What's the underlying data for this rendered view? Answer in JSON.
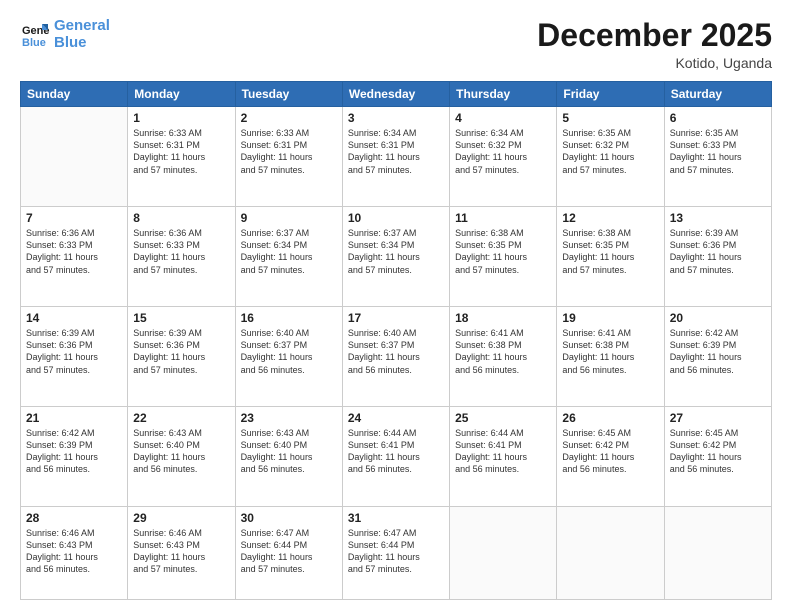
{
  "logo": {
    "line1": "General",
    "line2": "Blue"
  },
  "title": "December 2025",
  "subtitle": "Kotido, Uganda",
  "days_of_week": [
    "Sunday",
    "Monday",
    "Tuesday",
    "Wednesday",
    "Thursday",
    "Friday",
    "Saturday"
  ],
  "weeks": [
    [
      {
        "day": "",
        "info": ""
      },
      {
        "day": "1",
        "info": "Sunrise: 6:33 AM\nSunset: 6:31 PM\nDaylight: 11 hours\nand 57 minutes."
      },
      {
        "day": "2",
        "info": "Sunrise: 6:33 AM\nSunset: 6:31 PM\nDaylight: 11 hours\nand 57 minutes."
      },
      {
        "day": "3",
        "info": "Sunrise: 6:34 AM\nSunset: 6:31 PM\nDaylight: 11 hours\nand 57 minutes."
      },
      {
        "day": "4",
        "info": "Sunrise: 6:34 AM\nSunset: 6:32 PM\nDaylight: 11 hours\nand 57 minutes."
      },
      {
        "day": "5",
        "info": "Sunrise: 6:35 AM\nSunset: 6:32 PM\nDaylight: 11 hours\nand 57 minutes."
      },
      {
        "day": "6",
        "info": "Sunrise: 6:35 AM\nSunset: 6:33 PM\nDaylight: 11 hours\nand 57 minutes."
      }
    ],
    [
      {
        "day": "7",
        "info": "Sunrise: 6:36 AM\nSunset: 6:33 PM\nDaylight: 11 hours\nand 57 minutes."
      },
      {
        "day": "8",
        "info": "Sunrise: 6:36 AM\nSunset: 6:33 PM\nDaylight: 11 hours\nand 57 minutes."
      },
      {
        "day": "9",
        "info": "Sunrise: 6:37 AM\nSunset: 6:34 PM\nDaylight: 11 hours\nand 57 minutes."
      },
      {
        "day": "10",
        "info": "Sunrise: 6:37 AM\nSunset: 6:34 PM\nDaylight: 11 hours\nand 57 minutes."
      },
      {
        "day": "11",
        "info": "Sunrise: 6:38 AM\nSunset: 6:35 PM\nDaylight: 11 hours\nand 57 minutes."
      },
      {
        "day": "12",
        "info": "Sunrise: 6:38 AM\nSunset: 6:35 PM\nDaylight: 11 hours\nand 57 minutes."
      },
      {
        "day": "13",
        "info": "Sunrise: 6:39 AM\nSunset: 6:36 PM\nDaylight: 11 hours\nand 57 minutes."
      }
    ],
    [
      {
        "day": "14",
        "info": "Sunrise: 6:39 AM\nSunset: 6:36 PM\nDaylight: 11 hours\nand 57 minutes."
      },
      {
        "day": "15",
        "info": "Sunrise: 6:39 AM\nSunset: 6:36 PM\nDaylight: 11 hours\nand 57 minutes."
      },
      {
        "day": "16",
        "info": "Sunrise: 6:40 AM\nSunset: 6:37 PM\nDaylight: 11 hours\nand 56 minutes."
      },
      {
        "day": "17",
        "info": "Sunrise: 6:40 AM\nSunset: 6:37 PM\nDaylight: 11 hours\nand 56 minutes."
      },
      {
        "day": "18",
        "info": "Sunrise: 6:41 AM\nSunset: 6:38 PM\nDaylight: 11 hours\nand 56 minutes."
      },
      {
        "day": "19",
        "info": "Sunrise: 6:41 AM\nSunset: 6:38 PM\nDaylight: 11 hours\nand 56 minutes."
      },
      {
        "day": "20",
        "info": "Sunrise: 6:42 AM\nSunset: 6:39 PM\nDaylight: 11 hours\nand 56 minutes."
      }
    ],
    [
      {
        "day": "21",
        "info": "Sunrise: 6:42 AM\nSunset: 6:39 PM\nDaylight: 11 hours\nand 56 minutes."
      },
      {
        "day": "22",
        "info": "Sunrise: 6:43 AM\nSunset: 6:40 PM\nDaylight: 11 hours\nand 56 minutes."
      },
      {
        "day": "23",
        "info": "Sunrise: 6:43 AM\nSunset: 6:40 PM\nDaylight: 11 hours\nand 56 minutes."
      },
      {
        "day": "24",
        "info": "Sunrise: 6:44 AM\nSunset: 6:41 PM\nDaylight: 11 hours\nand 56 minutes."
      },
      {
        "day": "25",
        "info": "Sunrise: 6:44 AM\nSunset: 6:41 PM\nDaylight: 11 hours\nand 56 minutes."
      },
      {
        "day": "26",
        "info": "Sunrise: 6:45 AM\nSunset: 6:42 PM\nDaylight: 11 hours\nand 56 minutes."
      },
      {
        "day": "27",
        "info": "Sunrise: 6:45 AM\nSunset: 6:42 PM\nDaylight: 11 hours\nand 56 minutes."
      }
    ],
    [
      {
        "day": "28",
        "info": "Sunrise: 6:46 AM\nSunset: 6:43 PM\nDaylight: 11 hours\nand 56 minutes."
      },
      {
        "day": "29",
        "info": "Sunrise: 6:46 AM\nSunset: 6:43 PM\nDaylight: 11 hours\nand 57 minutes."
      },
      {
        "day": "30",
        "info": "Sunrise: 6:47 AM\nSunset: 6:44 PM\nDaylight: 11 hours\nand 57 minutes."
      },
      {
        "day": "31",
        "info": "Sunrise: 6:47 AM\nSunset: 6:44 PM\nDaylight: 11 hours\nand 57 minutes."
      },
      {
        "day": "",
        "info": ""
      },
      {
        "day": "",
        "info": ""
      },
      {
        "day": "",
        "info": ""
      }
    ]
  ]
}
